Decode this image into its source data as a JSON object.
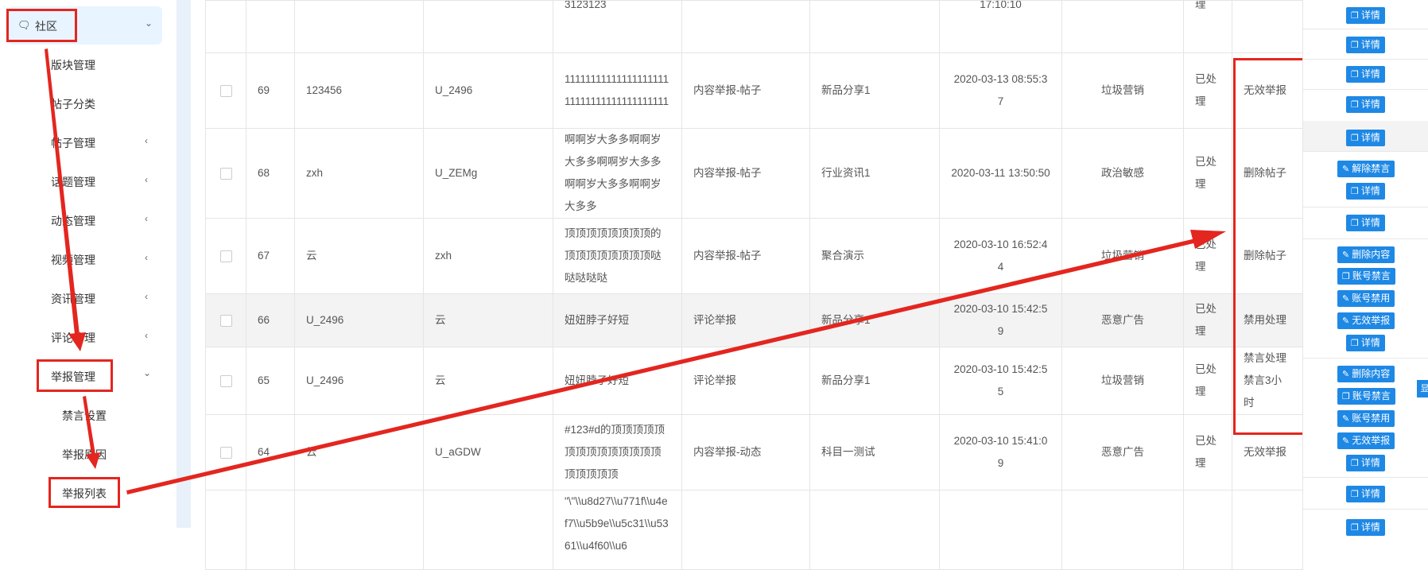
{
  "sidebar": {
    "top": {
      "label": "社区",
      "icon": "chat-icon"
    },
    "items": [
      {
        "label": "版块管理"
      },
      {
        "label": "帖子分类"
      },
      {
        "label": "帖子管理"
      },
      {
        "label": "话题管理"
      },
      {
        "label": "动态管理"
      },
      {
        "label": "视频管理"
      },
      {
        "label": "资讯管理"
      },
      {
        "label": "评论管理"
      },
      {
        "label": "举报管理"
      }
    ],
    "sub_items": [
      {
        "label": "禁言设置"
      },
      {
        "label": "举报原因"
      },
      {
        "label": "举报列表"
      }
    ]
  },
  "table": {
    "rows": [
      {
        "id": "",
        "reporter": "",
        "reported": "",
        "content": "3123123",
        "type": "",
        "source": "",
        "time": "17:10:10",
        "reason": "",
        "status": "理",
        "result": ""
      },
      {
        "id": "69",
        "reporter": "123456",
        "reported": "U_2496",
        "content": "1111111111111111111111111111111111111111",
        "type": "内容举报-帖子",
        "source": "新品分享1",
        "time": "2020-03-13 08:55:37",
        "reason": "垃圾营销",
        "status": "已处理",
        "result": "无效举报"
      },
      {
        "id": "68",
        "reporter": "zxh",
        "reported": "U_ZEMg",
        "content": "啊啊岁大多多啊啊岁大多多啊啊岁大多多啊啊岁大多多啊啊岁大多多",
        "type": "内容举报-帖子",
        "source": "行业资讯1",
        "time": "2020-03-11 13:50:50",
        "reason": "政治敏感",
        "status": "已处理",
        "result": "删除帖子"
      },
      {
        "id": "67",
        "reporter": "云",
        "reported": "zxh",
        "content": "顶顶顶顶顶顶顶顶的顶顶顶顶顶顶顶顶哒哒哒哒哒",
        "type": "内容举报-帖子",
        "source": "聚合演示",
        "time": "2020-03-10 16:52:44",
        "reason": "垃圾营销",
        "status": "已处理",
        "result": "删除帖子"
      },
      {
        "id": "66",
        "reporter": "U_2496",
        "reported": "云",
        "content": "妞妞脖子好短",
        "type": "评论举报",
        "source": "新品分享1",
        "time": "2020-03-10 15:42:59",
        "reason": "恶意广告",
        "status": "已处理",
        "result": "禁用处理"
      },
      {
        "id": "65",
        "reporter": "U_2496",
        "reported": "云",
        "content": "妞妞脖子好短",
        "type": "评论举报",
        "source": "新品分享1",
        "time": "2020-03-10 15:42:55",
        "reason": "垃圾营销",
        "status": "已处理",
        "result": "禁言处理 禁言3小时"
      },
      {
        "id": "64",
        "reporter": "云",
        "reported": "U_aGDW",
        "content": "#123#d的顶顶顶顶顶顶顶顶顶顶顶顶顶顶顶顶顶顶顶",
        "type": "内容举报-动态",
        "source": "科目一测试",
        "time": "2020-03-10 15:41:09",
        "reason": "恶意广告",
        "status": "已处理",
        "result": "无效举报"
      },
      {
        "id": "",
        "reporter": "",
        "reported": "",
        "content": "\"\\\"\\\\u8d27\\\\u771f\\\\u4ef7\\\\u5b9e\\\\u5c31\\\\u5361\\\\u4f60\\\\u6",
        "type": "",
        "source": "",
        "time": "",
        "reason": "",
        "status": "",
        "result": ""
      }
    ]
  },
  "actions": {
    "detail": "详情",
    "unban": "解除禁言",
    "delete_content": "删除内容",
    "account_mute": "账号禁言",
    "account_ban": "账号禁用",
    "invalid_report": "无效举报"
  },
  "side_tab": "显",
  "colors": {
    "accent": "#1e88e5",
    "annotation": "#e3261f",
    "highlight_row": "#f3f3f3"
  }
}
